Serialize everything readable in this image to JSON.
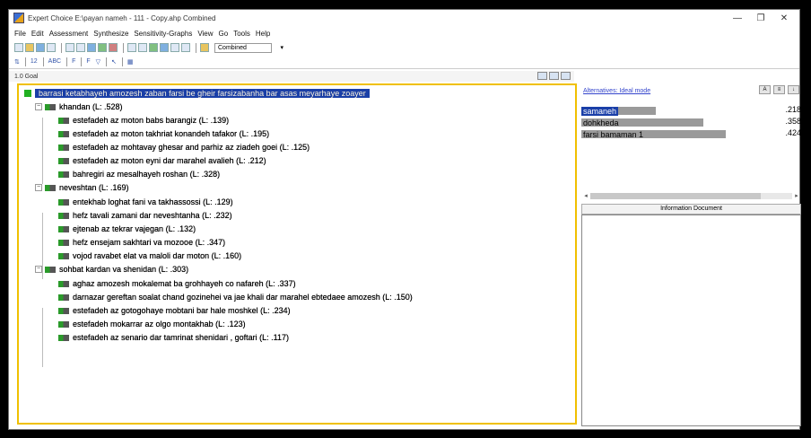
{
  "window": {
    "title": "Expert Choice   E:\\payan nameh - 111 - Copy.ahp   Combined",
    "controls": [
      "—",
      "❐",
      "✕"
    ]
  },
  "menu": [
    "File",
    "Edit",
    "Assessment",
    "Synthesize",
    "Sensitivity-Graphs",
    "View",
    "Go",
    "Tools",
    "Help"
  ],
  "toolbar": {
    "mode_select": "Combined",
    "row2_items": [
      "12",
      "ABC",
      "F",
      "F"
    ]
  },
  "status": {
    "left_text": "1.0 Goal"
  },
  "tree": {
    "goal": "barrasi ketabhayeh amozesh zaban farsi be gheir farsizabanha bar asas meyarhaye zoayer",
    "nodes": [
      {
        "label": "khandan (L: .528)",
        "level": 1
      },
      {
        "label": "estefadeh az moton babs barangiz (L: .139)",
        "level": 2
      },
      {
        "label": "estefadeh az moton takhriat konandeh tafakor (L: .195)",
        "level": 2
      },
      {
        "label": "estefadeh az mohtavay ghesar and parhiz az ziadeh goei (L: .125)",
        "level": 2
      },
      {
        "label": "estefadeh az moton eyni dar marahel avalieh (L: .212)",
        "level": 2
      },
      {
        "label": "bahregiri az mesalhayeh roshan (L: .328)",
        "level": 2
      },
      {
        "label": "neveshtan (L: .169)",
        "level": 1
      },
      {
        "label": "entekhab loghat fani va takhassossi (L: .129)",
        "level": 2
      },
      {
        "label": "hefz tavali zamani dar neveshtanha (L: .232)",
        "level": 2
      },
      {
        "label": "ejtenab az tekrar vajegan (L: .132)",
        "level": 2
      },
      {
        "label": "hefz ensejam sakhtari va mozooe (L: .347)",
        "level": 2
      },
      {
        "label": "vojod ravabet elat  va maloli dar moton (L: .160)",
        "level": 2
      },
      {
        "label": "sohbat kardan va shenidan (L: .303)",
        "level": 1
      },
      {
        "label": "aghaz amozesh mokalemat ba grohhayeh co nafareh (L: .337)",
        "level": 2
      },
      {
        "label": "darnazar gereftan soalat chand gozinehei va jae khali dar marahel ebtedaee amozesh (L: .150)",
        "level": 2
      },
      {
        "label": "estefadeh az gotogohaye mobtani bar hale moshkel (L: .234)",
        "level": 2
      },
      {
        "label": "estefadeh mokarrar az olgo montakhab (L: .123)",
        "level": 2
      },
      {
        "label": "estefadeh az senario dar tamrinat shenidari , goftari (L: .117)",
        "level": 2
      }
    ]
  },
  "right_panel": {
    "header_link": "Alternatives: Ideal mode",
    "buttons": [
      "A",
      "≡",
      "↓"
    ],
    "alternatives": [
      {
        "name": "samaneh",
        "value": ".218",
        "weight": 0.218,
        "selected": true
      },
      {
        "name": "dohkheda",
        "value": ".358",
        "weight": 0.358,
        "selected": false
      },
      {
        "name": "farsi bamaman 1",
        "value": ".424",
        "weight": 0.424,
        "selected": false
      }
    ],
    "info_title": "Information Document"
  },
  "colors": {
    "selection": "#1a3fa8",
    "panel_border": "#f0c000",
    "node_green": "#2a9a2a"
  }
}
